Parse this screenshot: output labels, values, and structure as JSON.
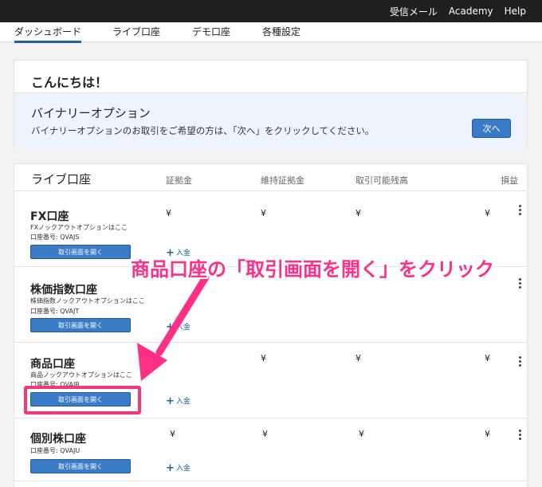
{
  "topbar": {
    "links": [
      "受信メール",
      "Academy",
      "Help"
    ]
  },
  "nav": {
    "tabs": [
      "ダッシュボード",
      "ライブ口座",
      "デモ口座",
      "各種設定"
    ]
  },
  "greeting": "こんにちは！",
  "binary": {
    "title": "バイナリーオプション",
    "description": "バイナリーオプションのお取引をご希望の方は、「次へ」をクリックしてください。",
    "next_label": "次へ"
  },
  "live_accounts": {
    "title": "ライブ口座",
    "columns": [
      "証拠金",
      "維持証拠金",
      "取引可能残高",
      "損益"
    ],
    "open_label": "取引画面を開く",
    "deposit_label": "入金",
    "currency_symbol": "¥",
    "rows": [
      {
        "name": "FX口座",
        "subtitle": "FXノックアウトオプションはここ",
        "account_no": "口座番号: QVAJS"
      },
      {
        "name": "株価指数口座",
        "subtitle": "株価指数ノックアウトオプションはここ",
        "account_no": "口座番号: QVAJT"
      },
      {
        "name": "商品口座",
        "subtitle": "商品ノックアウトオプションはここ",
        "account_no": "口座番号: QVAJR"
      },
      {
        "name": "個別株口座",
        "subtitle": "",
        "account_no": "口座番号: QVAJU"
      }
    ]
  },
  "annotation": {
    "text": "商品口座の「取引画面を開く」をクリック",
    "color": "#ff2f85"
  },
  "colors": {
    "primary_button": "#3a7bc8",
    "topbar": "#1f1f1f",
    "highlight": "#f0387b"
  }
}
